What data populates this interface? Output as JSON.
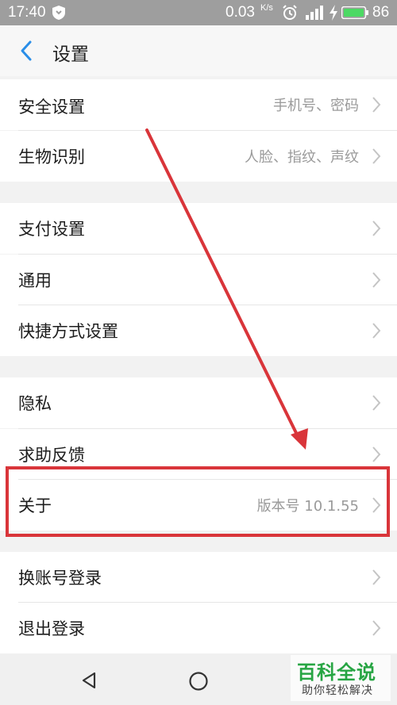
{
  "status_bar": {
    "time": "17:40",
    "speed": "0.03",
    "speed_unit": "K/s",
    "battery_percent": "86",
    "icons": [
      "shield-icon",
      "alarm-icon",
      "signal-icon",
      "charging-icon",
      "battery-icon"
    ]
  },
  "header": {
    "title": "设置",
    "back_icon": "chevron-left-icon"
  },
  "settings": {
    "groups": [
      {
        "items": [
          {
            "label": "安全设置",
            "value": "手机号、密码"
          },
          {
            "label": "生物识别",
            "value": "人脸、指纹、声纹"
          }
        ]
      },
      {
        "items": [
          {
            "label": "支付设置",
            "value": ""
          },
          {
            "label": "通用",
            "value": ""
          },
          {
            "label": "快捷方式设置",
            "value": ""
          }
        ]
      },
      {
        "items": [
          {
            "label": "隐私",
            "value": ""
          },
          {
            "label": "求助反馈",
            "value": ""
          },
          {
            "label": "关于",
            "value": "版本号 10.1.55"
          }
        ]
      },
      {
        "items": [
          {
            "label": "换账号登录",
            "value": ""
          },
          {
            "label": "退出登录",
            "value": ""
          }
        ]
      }
    ]
  },
  "nav_bar": {
    "icons": [
      "nav-back-icon",
      "nav-home-icon"
    ]
  },
  "watermark": {
    "title": "百科全说",
    "subtitle": "助你轻松解决"
  },
  "annotation": {
    "highlight_color": "#d9353a",
    "arrow_color": "#d9353a"
  }
}
